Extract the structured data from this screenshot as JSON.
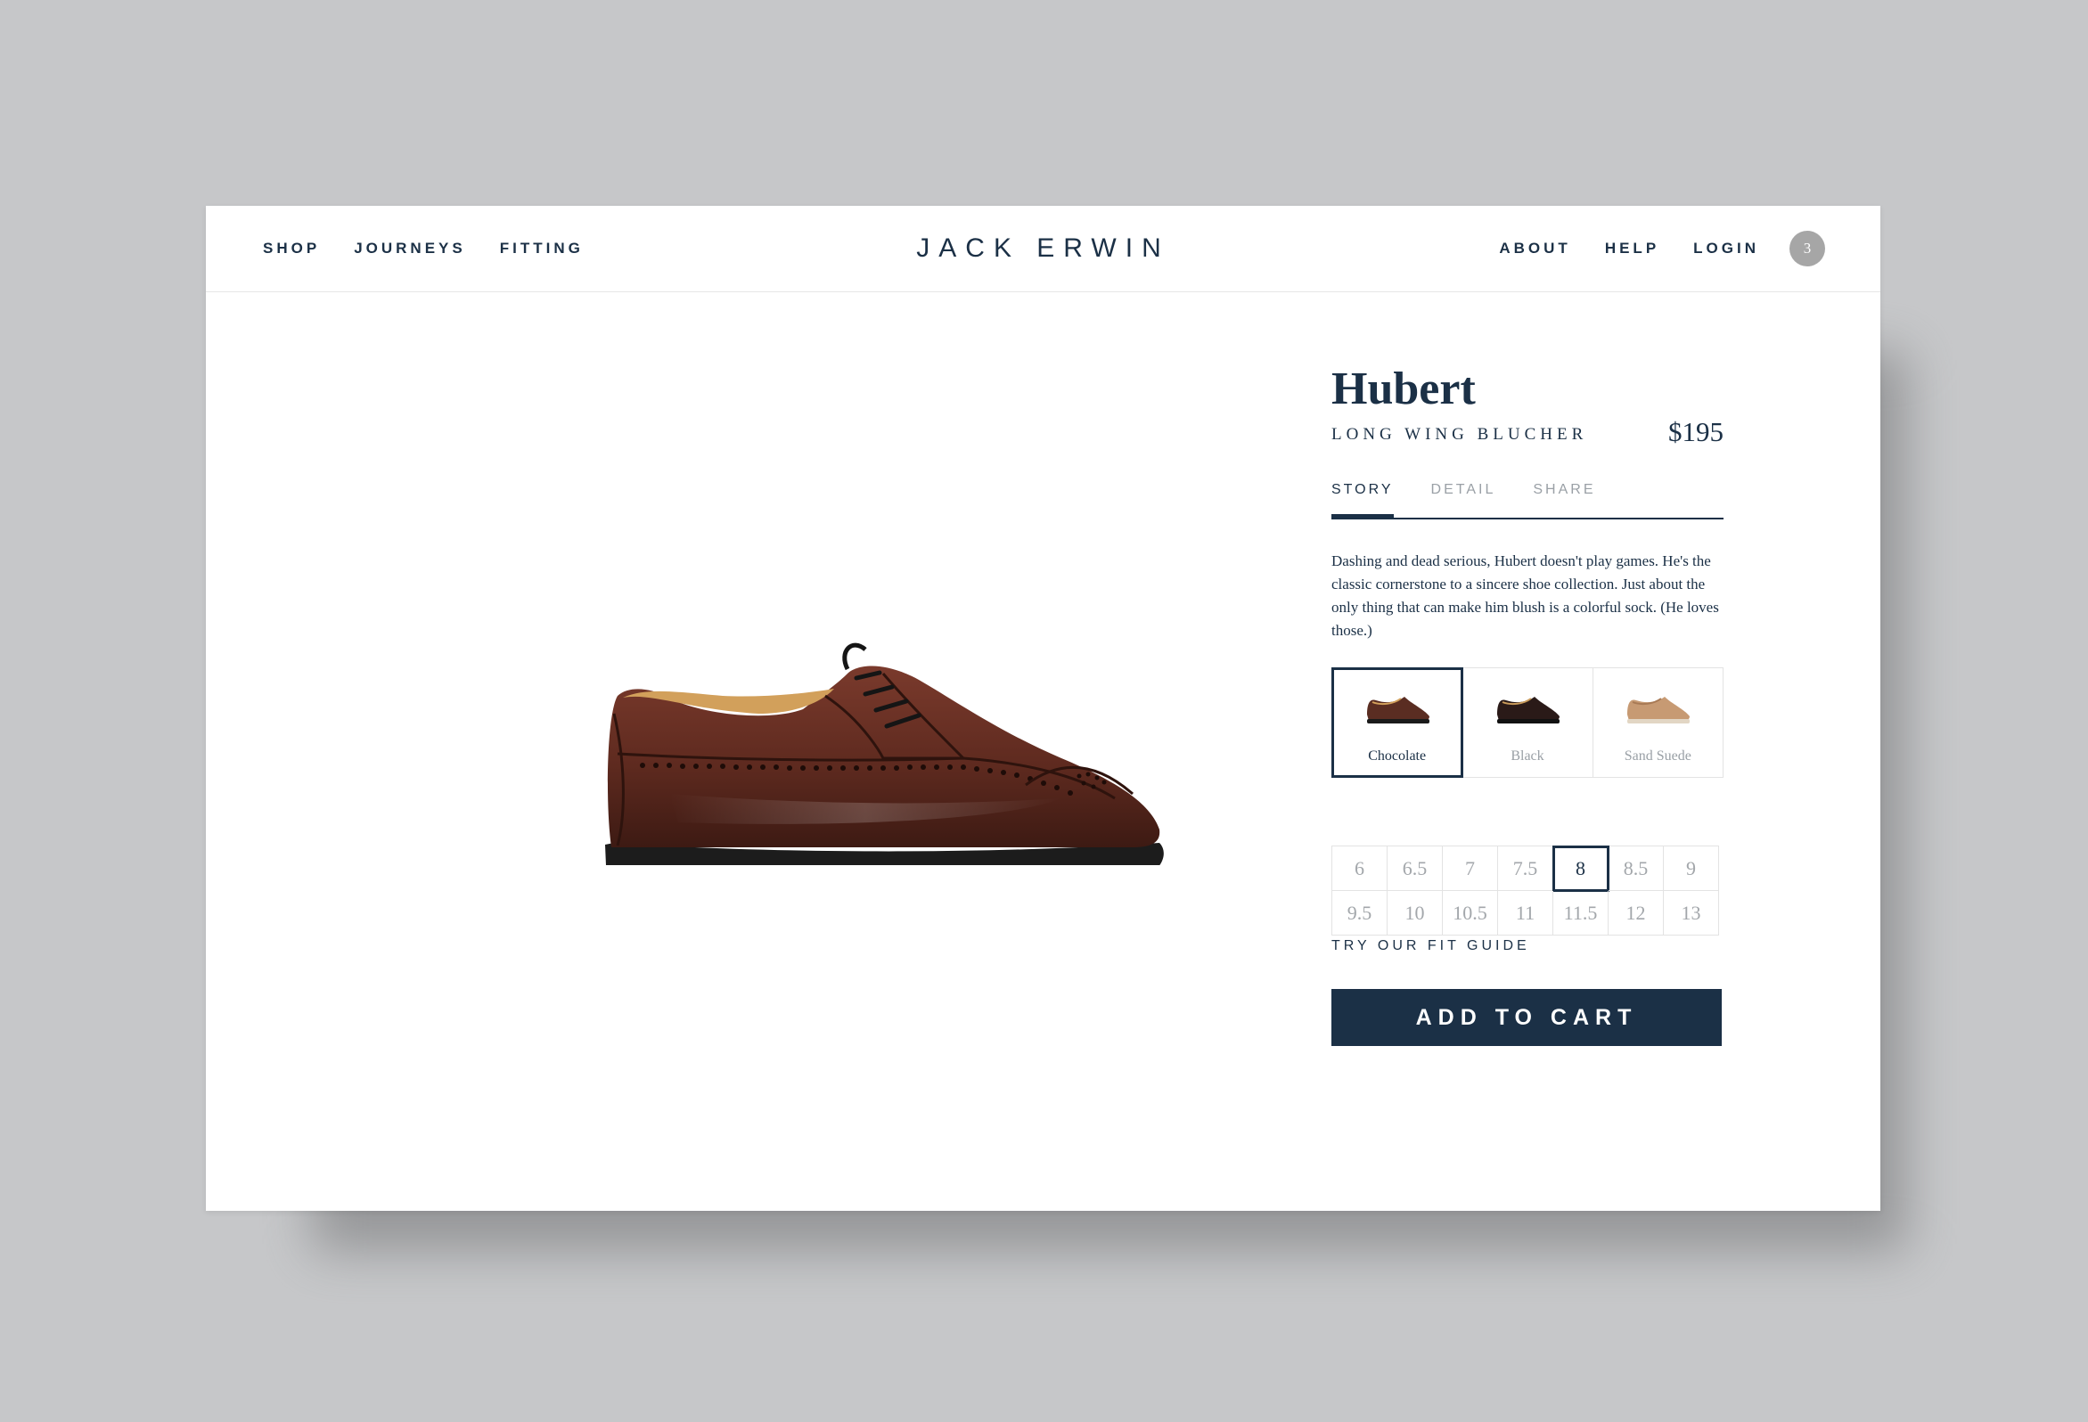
{
  "nav": {
    "left": [
      "SHOP",
      "JOURNEYS",
      "FITTING"
    ],
    "right": [
      "ABOUT",
      "HELP",
      "LOGIN"
    ],
    "cart_count": "3"
  },
  "brand": "JACK ERWIN",
  "product": {
    "name": "Hubert",
    "style": "LONG WING BLUCHER",
    "price": "$195",
    "tabs": [
      "STORY",
      "DETAIL",
      "SHARE"
    ],
    "active_tab": "STORY",
    "story": "Dashing and dead serious, Hubert doesn't play games. He's the classic cornerstone to a sincere shoe collection. Just about the only thing that can make him blush is a colorful sock. (He loves those.)",
    "colors": [
      {
        "label": "Chocolate",
        "hex": "#5a2d22"
      },
      {
        "label": "Black",
        "hex": "#2a1a18"
      },
      {
        "label": "Sand Suede",
        "hex": "#c79a73"
      }
    ],
    "selected_color": "Chocolate",
    "sizes": [
      "6",
      "6.5",
      "7",
      "7.5",
      "8",
      "8.5",
      "9",
      "9.5",
      "10",
      "10.5",
      "11",
      "11.5",
      "12",
      "13"
    ],
    "selected_size": "8",
    "fit_guide": "TRY OUR FIT GUIDE",
    "cta": "ADD TO CART"
  },
  "colors": {
    "navy": "#1b3046",
    "background": "#c6c7c9",
    "muted": "#9aa0a6"
  }
}
